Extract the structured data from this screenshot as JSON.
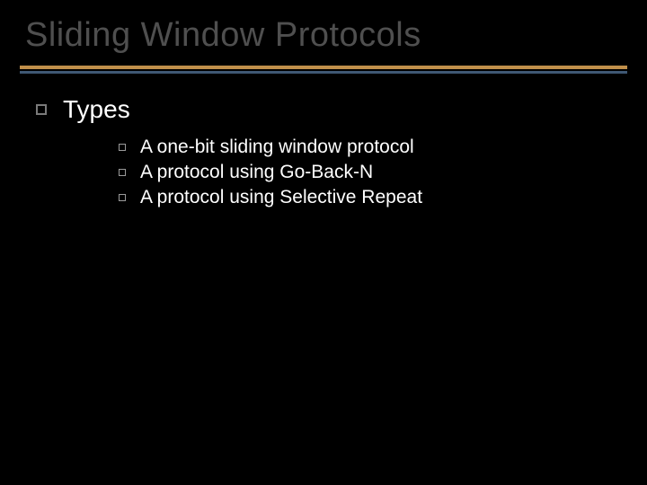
{
  "title": "Sliding Window Protocols",
  "content": {
    "heading": "Types",
    "items": [
      "A one-bit sliding window protocol",
      "A protocol using Go-Back-N",
      "A protocol using Selective Repeat"
    ]
  }
}
